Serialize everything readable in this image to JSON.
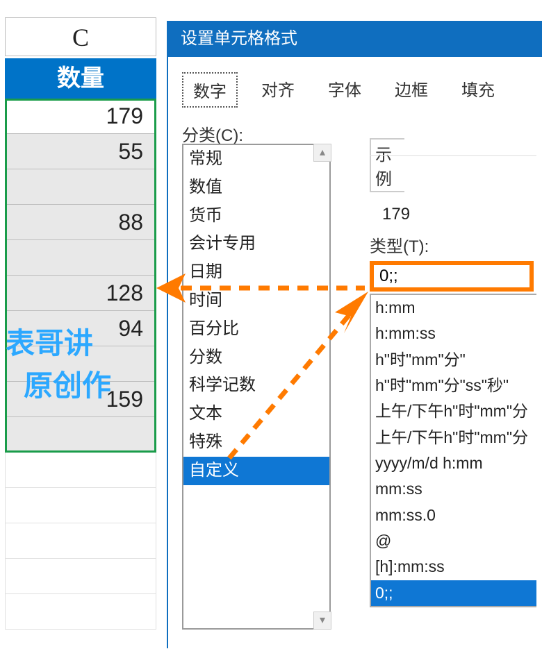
{
  "spreadsheet": {
    "column_letter": "C",
    "quantity_header": "数量",
    "cells": [
      "179",
      "55",
      "",
      "88",
      "",
      "128",
      "94",
      "",
      "159",
      ""
    ]
  },
  "watermark": {
    "line1": "表哥讲",
    "line2": "原创作"
  },
  "dialog": {
    "title": "设置单元格格式",
    "tabs": [
      "数字",
      "对齐",
      "字体",
      "边框",
      "填充"
    ],
    "category_label": "分类(C):",
    "categories": [
      "常规",
      "数值",
      "货币",
      "会计专用",
      "日期",
      "时间",
      "百分比",
      "分数",
      "科学记数",
      "文本",
      "特殊",
      "自定义"
    ],
    "sample_label": "示例",
    "sample_value": "179",
    "type_label": "类型(T):",
    "type_input_value": "0;;",
    "type_list": [
      "h:mm",
      "h:mm:ss",
      "h\"时\"mm\"分\"",
      "h\"时\"mm\"分\"ss\"秒\"",
      "上午/下午h\"时\"mm\"分",
      "上午/下午h\"时\"mm\"分",
      "yyyy/m/d h:mm",
      "mm:ss",
      "mm:ss.0",
      "@",
      "[h]:mm:ss",
      "0;;"
    ]
  }
}
